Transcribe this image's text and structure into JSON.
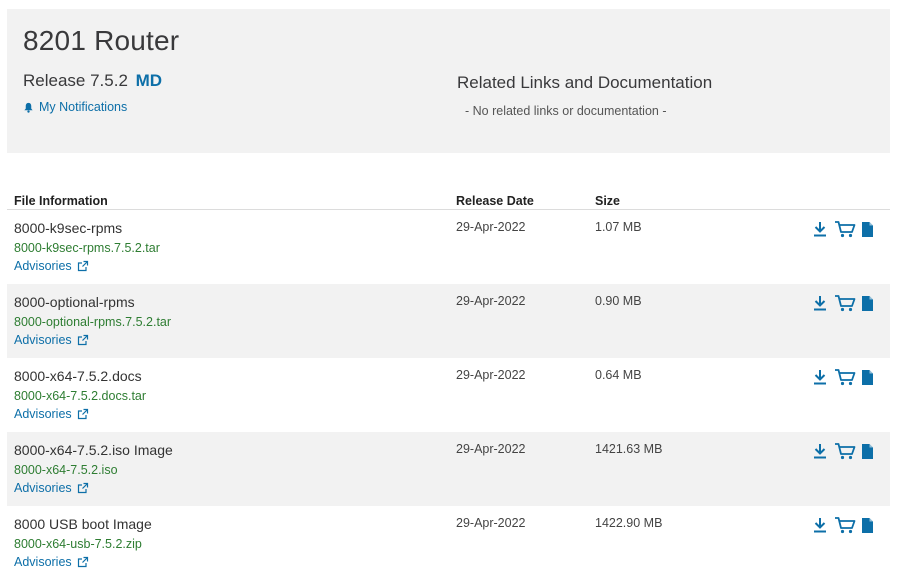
{
  "product": {
    "title": "8201 Router",
    "release_label": "Release 7.5.2",
    "release_tag": "MD",
    "notifications_label": "My Notifications"
  },
  "related": {
    "title": "Related Links and Documentation",
    "empty_text": "- No related links or documentation -"
  },
  "table": {
    "headers": {
      "file_info": "File Information",
      "release_date": "Release Date",
      "size": "Size"
    },
    "rows": [
      {
        "name": "8000-k9sec-rpms",
        "file": "8000-k9sec-rpms.7.5.2.tar",
        "advisories": "Advisories",
        "date": "29-Apr-2022",
        "size": "1.07 MB"
      },
      {
        "name": "8000-optional-rpms",
        "file": "8000-optional-rpms.7.5.2.tar",
        "advisories": "Advisories",
        "date": "29-Apr-2022",
        "size": "0.90 MB"
      },
      {
        "name": "8000-x64-7.5.2.docs",
        "file": "8000-x64-7.5.2.docs.tar",
        "advisories": "Advisories",
        "date": "29-Apr-2022",
        "size": "0.64 MB"
      },
      {
        "name": "8000-x64-7.5.2.iso Image",
        "file": "8000-x64-7.5.2.iso",
        "advisories": "Advisories",
        "date": "29-Apr-2022",
        "size": "1421.63 MB"
      },
      {
        "name": "8000 USB boot Image",
        "file": "8000-x64-usb-7.5.2.zip",
        "advisories": "Advisories",
        "date": "29-Apr-2022",
        "size": "1422.90 MB"
      }
    ]
  },
  "icons": {
    "notifications": "bell-icon",
    "advisories": "external-link-icon",
    "download": "download-icon",
    "cart": "cart-icon",
    "details": "document-icon"
  },
  "colors": {
    "panel_bg": "#f2f2f2",
    "link_blue": "#0d6fa8",
    "file_green": "#2e7d32",
    "row_shade": "#f2f2f2"
  }
}
